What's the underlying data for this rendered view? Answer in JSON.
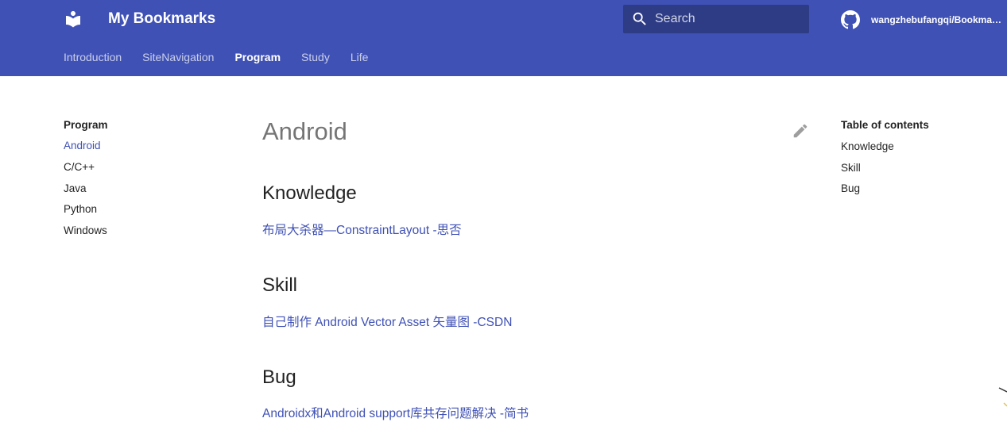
{
  "header": {
    "site_title": "My Bookmarks",
    "search_placeholder": "Search",
    "repo_name": "wangzhebufangqi/Bookmarks",
    "background_color": "#3f51b5",
    "logo_icon": "book-reader-icon",
    "search_icon": "search-icon",
    "repo_icon": "github-icon"
  },
  "tabs": [
    {
      "label": "Introduction",
      "active": false
    },
    {
      "label": "SiteNavigation",
      "active": false
    },
    {
      "label": "Program",
      "active": true
    },
    {
      "label": "Study",
      "active": false
    },
    {
      "label": "Life",
      "active": false
    }
  ],
  "left_nav": {
    "title": "Program",
    "items": [
      {
        "label": "Android",
        "active": true
      },
      {
        "label": "C/C++",
        "active": false
      },
      {
        "label": "Java",
        "active": false
      },
      {
        "label": "Python",
        "active": false
      },
      {
        "label": "Windows",
        "active": false
      }
    ]
  },
  "main": {
    "title": "Android",
    "edit_icon": "pencil-icon",
    "sections": [
      {
        "heading": "Knowledge",
        "link": "布局大杀器—ConstraintLayout -思否"
      },
      {
        "heading": "Skill",
        "link": "自己制作 Android Vector Asset 矢量图 -CSDN"
      },
      {
        "heading": "Bug",
        "link": "Androidx和Android support库共存问题解决 -简书"
      }
    ]
  },
  "toc": {
    "title": "Table of contents",
    "items": [
      "Knowledge",
      "Skill",
      "Bug"
    ]
  },
  "colors": {
    "primary": "#3f51b5",
    "link": "#3f51b5"
  }
}
